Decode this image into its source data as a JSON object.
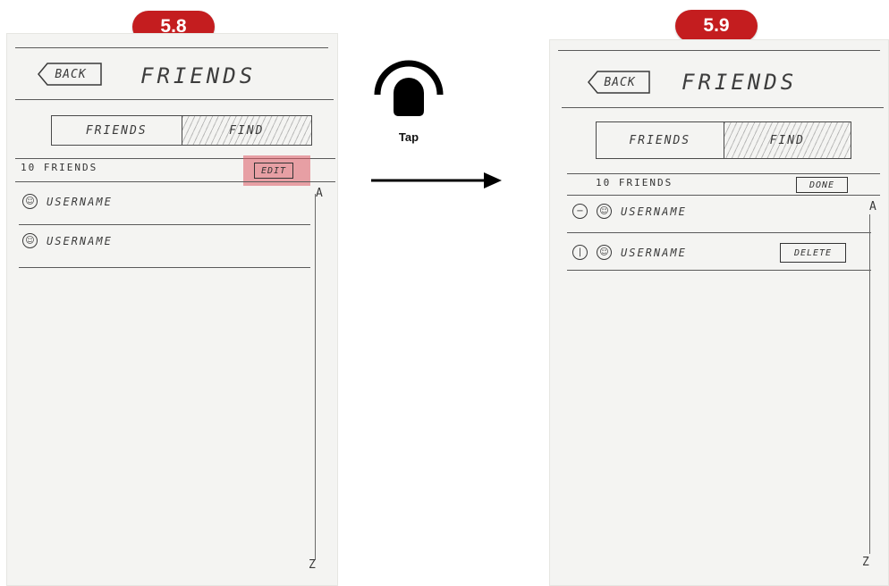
{
  "steps": {
    "left_label": "5.8",
    "right_label": "5.9",
    "badge_color": "#c41d1f"
  },
  "gesture": {
    "label": "Tap",
    "icon": "finger-tap-icon",
    "direction_icon": "arrow-right-icon"
  },
  "screen_before": {
    "back_label": "BACK",
    "title": "FRIENDS",
    "tabs": [
      {
        "label": "FRIENDS",
        "selected": false
      },
      {
        "label": "FIND",
        "selected": true
      }
    ],
    "count_label": "10 FRIENDS",
    "edit_label": "EDIT",
    "rows": [
      {
        "username": "USERNAME"
      },
      {
        "username": "USERNAME"
      }
    ],
    "index_top": "A",
    "index_bottom": "Z",
    "highlight_color": "#dc5a64"
  },
  "screen_after": {
    "back_label": "BACK",
    "title": "FRIENDS",
    "tabs": [
      {
        "label": "FRIENDS",
        "selected": false
      },
      {
        "label": "FIND",
        "selected": true
      }
    ],
    "count_label": "10 FRIENDS",
    "done_label": "DONE",
    "rows": [
      {
        "control_glyph": "−",
        "username": "USERNAME"
      },
      {
        "control_glyph": "|",
        "username": "USERNAME",
        "delete_label": "DELETE"
      }
    ],
    "index_top": "A",
    "index_bottom": "Z"
  }
}
